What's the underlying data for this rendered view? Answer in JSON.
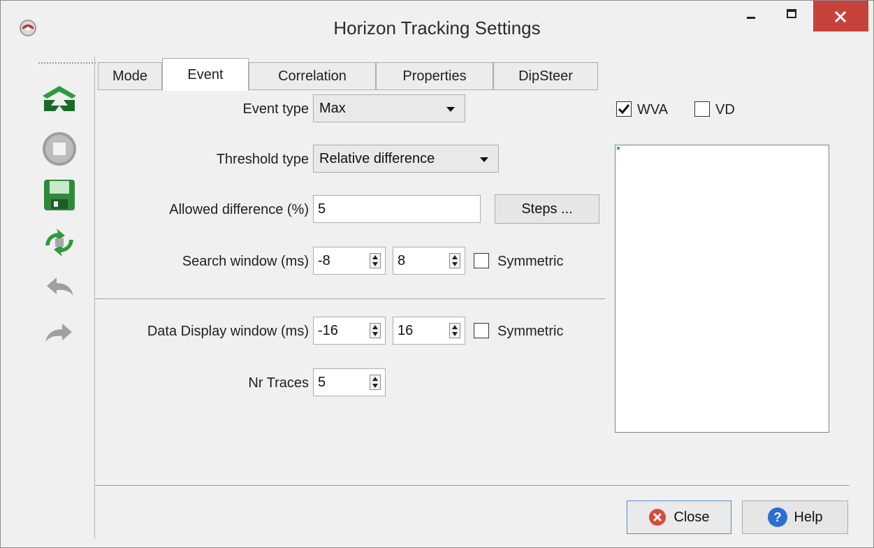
{
  "window": {
    "title": "Horizon Tracking Settings",
    "icons": {
      "app": "app-logo-icon",
      "minimize": "minimize-icon",
      "maximize": "maximize-icon",
      "close": "close-x-icon"
    },
    "colors": {
      "close_button": "#c7423a",
      "preview_marker": "#22cc22"
    }
  },
  "toolbar": {
    "tools": [
      "track-horizon-icon",
      "stop-icon",
      "save-icon",
      "retrack-icon",
      "undo-icon",
      "redo-icon"
    ]
  },
  "tabs": [
    {
      "label": "Mode"
    },
    {
      "label": "Event"
    },
    {
      "label": "Correlation"
    },
    {
      "label": "Properties"
    },
    {
      "label": "DipSteer"
    }
  ],
  "active_tab": "Event",
  "form": {
    "event_type_label": "Event type",
    "event_type_value": "Max",
    "threshold_type_label": "Threshold type",
    "threshold_type_value": "Relative difference",
    "allowed_diff_label": "Allowed difference (%)",
    "allowed_diff_value": "5",
    "steps_button": "Steps ...",
    "search_window_label": "Search window (ms)",
    "search_window_start": "-8",
    "search_window_end": "8",
    "search_symmetric_label": "Symmetric",
    "search_symmetric_checked": false,
    "data_display_label": "Data Display window (ms)",
    "data_display_start": "-16",
    "data_display_end": "16",
    "display_symmetric_label": "Symmetric",
    "display_symmetric_checked": false,
    "nr_traces_label": "Nr Traces",
    "nr_traces_value": "5"
  },
  "display_options": {
    "wva_label": "WVA",
    "wva_checked": true,
    "vd_label": "VD",
    "vd_checked": false
  },
  "footer": {
    "close_label": "Close",
    "help_label": "Help"
  }
}
